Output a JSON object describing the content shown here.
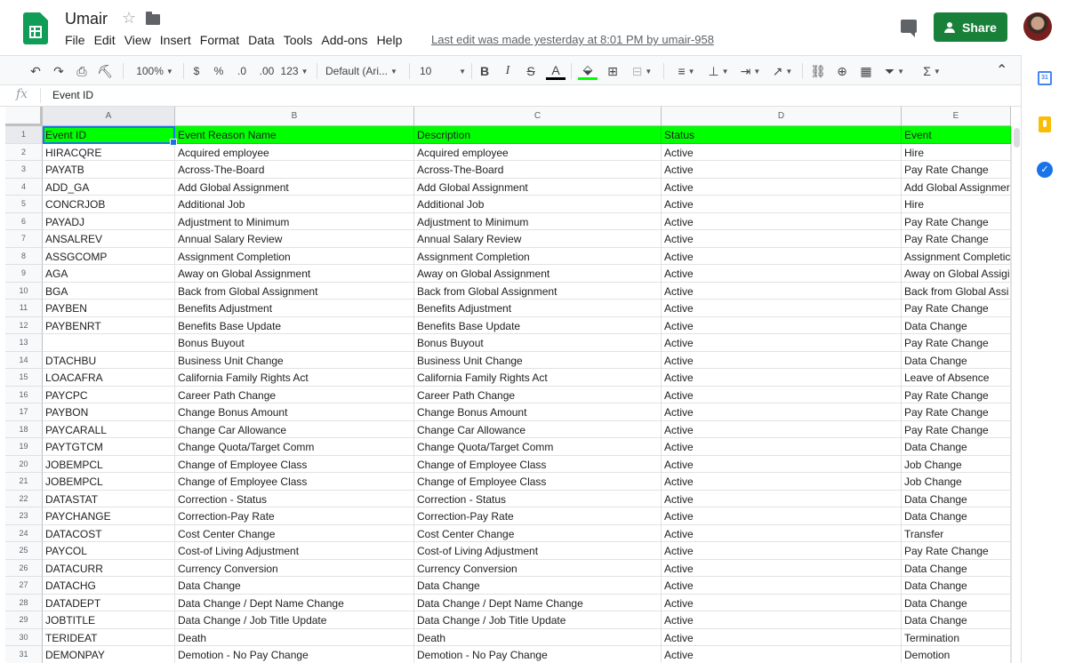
{
  "app": {
    "title": "Umair",
    "menu": [
      "File",
      "Edit",
      "View",
      "Insert",
      "Format",
      "Data",
      "Tools",
      "Add-ons",
      "Help"
    ],
    "last_edit": "Last edit was made yesterday at 8:01 PM by umair-958",
    "share_label": "Share",
    "brand_color": "#0f9d58",
    "share_color": "#188038"
  },
  "toolbar": {
    "zoom": "100%",
    "currency": "$",
    "percent": "%",
    "dec_decrease": ".0",
    "dec_increase": ".00",
    "more_formats": "123",
    "font": "Default (Ari...",
    "font_size": "10",
    "bold": "B",
    "italic": "I",
    "strike": "S",
    "text_color": "A"
  },
  "formula_bar": {
    "fx": "fx",
    "value": "Event ID"
  },
  "sheet": {
    "columns": [
      "A",
      "B",
      "C",
      "D",
      "E"
    ],
    "header_fill": "#00ff00",
    "rows": [
      {
        "n": "1",
        "cells": [
          "Event ID",
          "Event Reason Name",
          "Description",
          "Status",
          "Event"
        ]
      },
      {
        "n": "2",
        "cells": [
          "HIRACQRE",
          "Acquired employee",
          "Acquired employee",
          "Active",
          "Hire"
        ]
      },
      {
        "n": "3",
        "cells": [
          "PAYATB",
          "Across-The-Board",
          "Across-The-Board",
          "Active",
          "Pay Rate Change"
        ]
      },
      {
        "n": "4",
        "cells": [
          "ADD_GA",
          "Add Global Assignment",
          "Add Global Assignment",
          "Active",
          "Add Global Assignmer"
        ]
      },
      {
        "n": "5",
        "cells": [
          "CONCRJOB",
          "Additional Job",
          "Additional Job",
          "Active",
          "Hire"
        ]
      },
      {
        "n": "6",
        "cells": [
          "PAYADJ",
          "Adjustment to Minimum",
          "Adjustment to Minimum",
          "Active",
          "Pay Rate Change"
        ]
      },
      {
        "n": "7",
        "cells": [
          "ANSALREV",
          "Annual Salary Review",
          "Annual Salary Review",
          "Active",
          "Pay Rate Change"
        ]
      },
      {
        "n": "8",
        "cells": [
          "ASSGCOMP",
          "Assignment Completion",
          "Assignment Completion",
          "Active",
          "Assignment Completic"
        ]
      },
      {
        "n": "9",
        "cells": [
          "AGA",
          "Away on Global Assignment",
          "Away on Global Assignment",
          "Active",
          "Away on Global Assigi"
        ]
      },
      {
        "n": "10",
        "cells": [
          "BGA",
          "Back from Global Assignment",
          "Back from Global Assignment",
          "Active",
          "Back from Global Assi"
        ]
      },
      {
        "n": "11",
        "cells": [
          "PAYBEN",
          "Benefits Adjustment",
          "Benefits Adjustment",
          "Active",
          "Pay Rate Change"
        ]
      },
      {
        "n": "12",
        "cells": [
          "PAYBENRT",
          "Benefits Base Update",
          "Benefits Base Update",
          "Active",
          "Data Change"
        ]
      },
      {
        "n": "13",
        "cells": [
          "",
          "Bonus Buyout",
          "Bonus Buyout",
          "Active",
          "Pay Rate Change"
        ]
      },
      {
        "n": "14",
        "cells": [
          "DTACHBU",
          "Business Unit Change",
          "Business Unit Change",
          "Active",
          "Data Change"
        ]
      },
      {
        "n": "15",
        "cells": [
          "LOACAFRA",
          "California Family Rights Act",
          "California Family Rights Act",
          "Active",
          "Leave of Absence"
        ]
      },
      {
        "n": "16",
        "cells": [
          "PAYCPC",
          "Career Path Change",
          "Career Path Change",
          "Active",
          "Pay Rate Change"
        ]
      },
      {
        "n": "17",
        "cells": [
          "PAYBON",
          "Change Bonus Amount",
          "Change Bonus Amount",
          "Active",
          "Pay Rate Change"
        ]
      },
      {
        "n": "18",
        "cells": [
          "PAYCARALL",
          "Change Car Allowance",
          "Change Car Allowance",
          "Active",
          "Pay Rate Change"
        ]
      },
      {
        "n": "19",
        "cells": [
          "PAYTGTCM",
          "Change Quota/Target Comm",
          "Change Quota/Target Comm",
          "Active",
          "Data Change"
        ]
      },
      {
        "n": "20",
        "cells": [
          "JOBEMPCL",
          "Change of Employee Class",
          "Change of Employee Class",
          "Active",
          "Job Change"
        ]
      },
      {
        "n": "21",
        "cells": [
          "JOBEMPCL",
          "Change of Employee Class",
          "Change of Employee Class",
          "Active",
          "Job Change"
        ]
      },
      {
        "n": "22",
        "cells": [
          "DATASTAT",
          "Correction - Status",
          "Correction - Status",
          "Active",
          "Data Change"
        ]
      },
      {
        "n": "23",
        "cells": [
          "PAYCHANGE",
          "Correction-Pay Rate",
          "Correction-Pay Rate",
          "Active",
          "Data Change"
        ]
      },
      {
        "n": "24",
        "cells": [
          "DATACOST",
          "Cost Center Change",
          "Cost Center Change",
          "Active",
          "Transfer"
        ]
      },
      {
        "n": "25",
        "cells": [
          "PAYCOL",
          "Cost-of Living Adjustment",
          "Cost-of Living Adjustment",
          "Active",
          "Pay Rate Change"
        ]
      },
      {
        "n": "26",
        "cells": [
          "DATACURR",
          "Currency Conversion",
          "Currency Conversion",
          "Active",
          "Data Change"
        ]
      },
      {
        "n": "27",
        "cells": [
          "DATACHG",
          "Data Change",
          "Data Change",
          "Active",
          "Data Change"
        ]
      },
      {
        "n": "28",
        "cells": [
          "DATADEPT",
          "Data Change / Dept Name Change",
          "Data Change / Dept Name Change",
          "Active",
          "Data Change"
        ]
      },
      {
        "n": "29",
        "cells": [
          "JOBTITLE",
          "Data Change / Job Title Update",
          "Data Change / Job Title Update",
          "Active",
          "Data Change"
        ]
      },
      {
        "n": "30",
        "cells": [
          "TERIDEAT",
          "Death",
          "Death",
          "Active",
          "Termination"
        ]
      },
      {
        "n": "31",
        "cells": [
          "DEMONPAY",
          "Demotion - No Pay Change",
          "Demotion - No Pay Change",
          "Active",
          "Demotion"
        ]
      }
    ]
  },
  "side_panel": {
    "calendar_label": "31"
  }
}
